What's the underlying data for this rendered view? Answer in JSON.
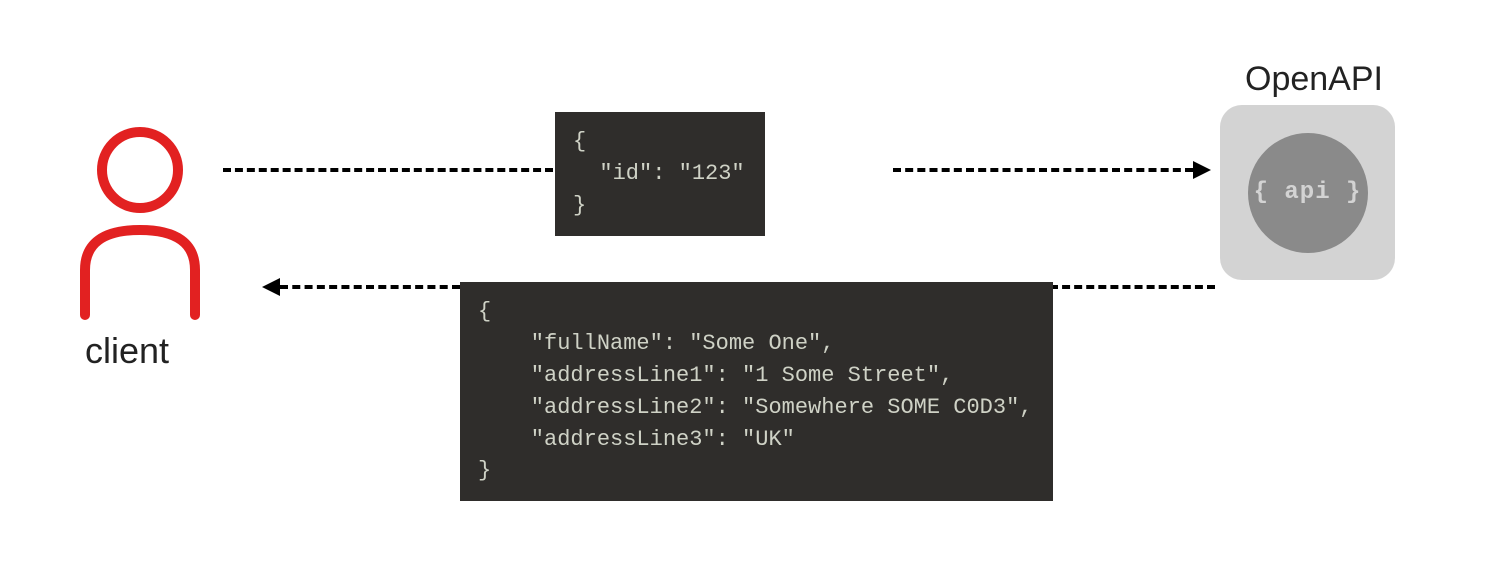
{
  "client": {
    "label": "client"
  },
  "api": {
    "label": "OpenAPI",
    "badge": "{ api }"
  },
  "request": {
    "code": "{\n  \"id\": \"123\"\n}"
  },
  "response": {
    "code": "{\n    \"fullName\": \"Some One\",\n    \"addressLine1\": \"1 Some Street\",\n    \"addressLine2\": \"Somewhere SOME C0D3\",\n    \"addressLine3\": \"UK\"\n}"
  }
}
